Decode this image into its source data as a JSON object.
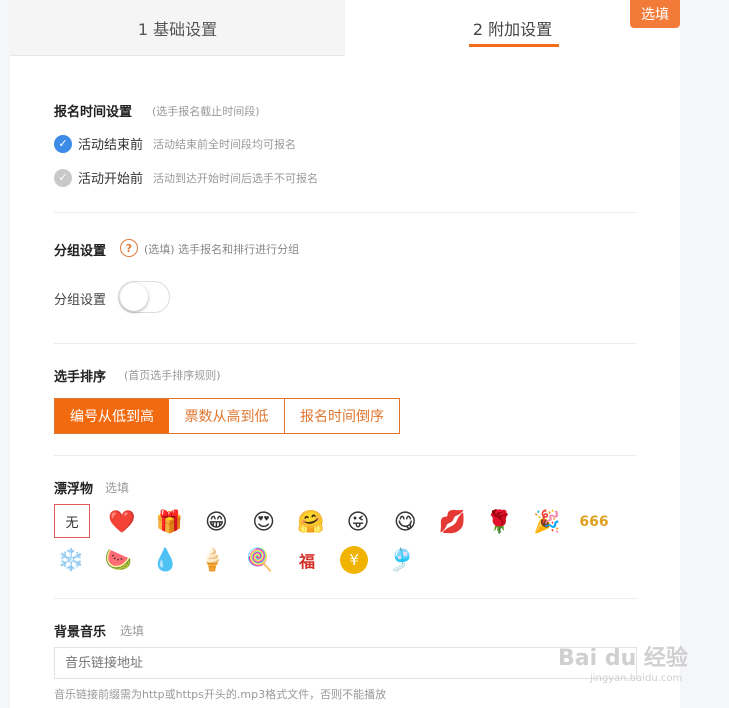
{
  "tabs": {
    "basic": "1 基础设置",
    "extra": "2 附加设置",
    "badge": "选填"
  },
  "signup_time": {
    "title": "报名时间设置",
    "hint": "(选手报名截止时间段)",
    "options": [
      {
        "label": "活动结束前",
        "desc": "活动结束前全时间段均可报名",
        "checked": true
      },
      {
        "label": "活动开始前",
        "desc": "活动到达开始时间后选手不可报名",
        "checked": false
      }
    ]
  },
  "group": {
    "title": "分组设置",
    "help_icon": "?",
    "hint": "(选填) 选手报名和排行进行分组",
    "toggle_label": "分组设置",
    "toggle_on": false
  },
  "ranking": {
    "title": "选手排序",
    "hint": "(首页选手排序规则)",
    "options": [
      "编号从低到高",
      "票数从高到低",
      "报名时间倒序"
    ],
    "selected_index": 0
  },
  "floats": {
    "title": "漂浮物",
    "hint": "选填",
    "none_label": "无",
    "items": [
      {
        "icon": "heart-icon",
        "glyph": "❤️"
      },
      {
        "icon": "gift-icon",
        "glyph": "🎁"
      },
      {
        "icon": "grin-icon",
        "glyph": "😁"
      },
      {
        "icon": "heart-eyes-icon",
        "glyph": "😍"
      },
      {
        "icon": "blush-hands-icon",
        "glyph": "🤗"
      },
      {
        "icon": "wink-tongue-icon",
        "glyph": "😜"
      },
      {
        "icon": "yum-icon",
        "glyph": "😋"
      },
      {
        "icon": "lips-icon",
        "glyph": "💋"
      },
      {
        "icon": "rose-icon",
        "glyph": "🌹"
      },
      {
        "icon": "party-popper-icon",
        "glyph": "🎉"
      },
      {
        "icon": "666-icon",
        "glyph": "666"
      },
      {
        "icon": "snowflake-icon",
        "glyph": "❄️"
      },
      {
        "icon": "watermelon-icon",
        "glyph": "🍉"
      },
      {
        "icon": "droplet-icon",
        "glyph": "💧"
      },
      {
        "icon": "ice-cream-icon",
        "glyph": "🍦"
      },
      {
        "icon": "lollipop-icon",
        "glyph": "🍭"
      },
      {
        "icon": "fu-icon",
        "glyph": "福"
      },
      {
        "icon": "gold-coin-icon",
        "glyph": "¥"
      },
      {
        "icon": "chinese-knot-icon",
        "glyph": "🎐"
      }
    ]
  },
  "music": {
    "title": "背景音乐",
    "hint": "选填",
    "placeholder": "音乐链接地址",
    "note": "音乐链接前缀需为http或https开头的.mp3格式文件，否则不能播放"
  },
  "watermark": {
    "text": "Bai du 经验",
    "sub": "jingyan.baidu.com"
  },
  "colors": {
    "accent": "#f26a10",
    "check_blue": "#3c8ce7"
  }
}
